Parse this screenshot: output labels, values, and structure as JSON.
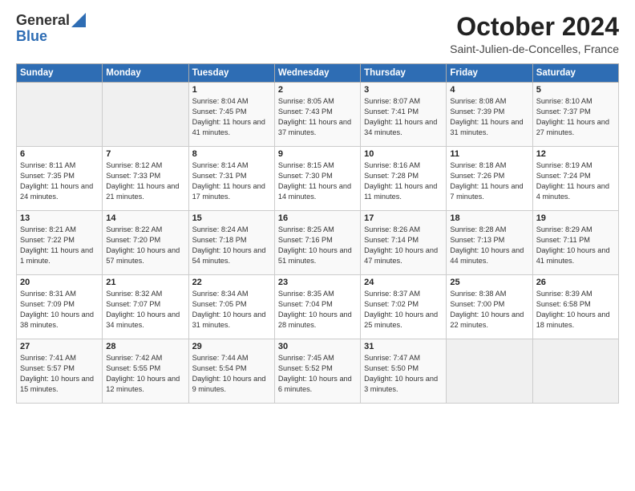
{
  "logo": {
    "general": "General",
    "blue": "Blue"
  },
  "title": "October 2024",
  "location": "Saint-Julien-de-Concelles, France",
  "headers": [
    "Sunday",
    "Monday",
    "Tuesday",
    "Wednesday",
    "Thursday",
    "Friday",
    "Saturday"
  ],
  "weeks": [
    [
      {
        "day": "",
        "info": ""
      },
      {
        "day": "",
        "info": ""
      },
      {
        "day": "1",
        "info": "Sunrise: 8:04 AM\nSunset: 7:45 PM\nDaylight: 11 hours and 41 minutes."
      },
      {
        "day": "2",
        "info": "Sunrise: 8:05 AM\nSunset: 7:43 PM\nDaylight: 11 hours and 37 minutes."
      },
      {
        "day": "3",
        "info": "Sunrise: 8:07 AM\nSunset: 7:41 PM\nDaylight: 11 hours and 34 minutes."
      },
      {
        "day": "4",
        "info": "Sunrise: 8:08 AM\nSunset: 7:39 PM\nDaylight: 11 hours and 31 minutes."
      },
      {
        "day": "5",
        "info": "Sunrise: 8:10 AM\nSunset: 7:37 PM\nDaylight: 11 hours and 27 minutes."
      }
    ],
    [
      {
        "day": "6",
        "info": "Sunrise: 8:11 AM\nSunset: 7:35 PM\nDaylight: 11 hours and 24 minutes."
      },
      {
        "day": "7",
        "info": "Sunrise: 8:12 AM\nSunset: 7:33 PM\nDaylight: 11 hours and 21 minutes."
      },
      {
        "day": "8",
        "info": "Sunrise: 8:14 AM\nSunset: 7:31 PM\nDaylight: 11 hours and 17 minutes."
      },
      {
        "day": "9",
        "info": "Sunrise: 8:15 AM\nSunset: 7:30 PM\nDaylight: 11 hours and 14 minutes."
      },
      {
        "day": "10",
        "info": "Sunrise: 8:16 AM\nSunset: 7:28 PM\nDaylight: 11 hours and 11 minutes."
      },
      {
        "day": "11",
        "info": "Sunrise: 8:18 AM\nSunset: 7:26 PM\nDaylight: 11 hours and 7 minutes."
      },
      {
        "day": "12",
        "info": "Sunrise: 8:19 AM\nSunset: 7:24 PM\nDaylight: 11 hours and 4 minutes."
      }
    ],
    [
      {
        "day": "13",
        "info": "Sunrise: 8:21 AM\nSunset: 7:22 PM\nDaylight: 11 hours and 1 minute."
      },
      {
        "day": "14",
        "info": "Sunrise: 8:22 AM\nSunset: 7:20 PM\nDaylight: 10 hours and 57 minutes."
      },
      {
        "day": "15",
        "info": "Sunrise: 8:24 AM\nSunset: 7:18 PM\nDaylight: 10 hours and 54 minutes."
      },
      {
        "day": "16",
        "info": "Sunrise: 8:25 AM\nSunset: 7:16 PM\nDaylight: 10 hours and 51 minutes."
      },
      {
        "day": "17",
        "info": "Sunrise: 8:26 AM\nSunset: 7:14 PM\nDaylight: 10 hours and 47 minutes."
      },
      {
        "day": "18",
        "info": "Sunrise: 8:28 AM\nSunset: 7:13 PM\nDaylight: 10 hours and 44 minutes."
      },
      {
        "day": "19",
        "info": "Sunrise: 8:29 AM\nSunset: 7:11 PM\nDaylight: 10 hours and 41 minutes."
      }
    ],
    [
      {
        "day": "20",
        "info": "Sunrise: 8:31 AM\nSunset: 7:09 PM\nDaylight: 10 hours and 38 minutes."
      },
      {
        "day": "21",
        "info": "Sunrise: 8:32 AM\nSunset: 7:07 PM\nDaylight: 10 hours and 34 minutes."
      },
      {
        "day": "22",
        "info": "Sunrise: 8:34 AM\nSunset: 7:05 PM\nDaylight: 10 hours and 31 minutes."
      },
      {
        "day": "23",
        "info": "Sunrise: 8:35 AM\nSunset: 7:04 PM\nDaylight: 10 hours and 28 minutes."
      },
      {
        "day": "24",
        "info": "Sunrise: 8:37 AM\nSunset: 7:02 PM\nDaylight: 10 hours and 25 minutes."
      },
      {
        "day": "25",
        "info": "Sunrise: 8:38 AM\nSunset: 7:00 PM\nDaylight: 10 hours and 22 minutes."
      },
      {
        "day": "26",
        "info": "Sunrise: 8:39 AM\nSunset: 6:58 PM\nDaylight: 10 hours and 18 minutes."
      }
    ],
    [
      {
        "day": "27",
        "info": "Sunrise: 7:41 AM\nSunset: 5:57 PM\nDaylight: 10 hours and 15 minutes."
      },
      {
        "day": "28",
        "info": "Sunrise: 7:42 AM\nSunset: 5:55 PM\nDaylight: 10 hours and 12 minutes."
      },
      {
        "day": "29",
        "info": "Sunrise: 7:44 AM\nSunset: 5:54 PM\nDaylight: 10 hours and 9 minutes."
      },
      {
        "day": "30",
        "info": "Sunrise: 7:45 AM\nSunset: 5:52 PM\nDaylight: 10 hours and 6 minutes."
      },
      {
        "day": "31",
        "info": "Sunrise: 7:47 AM\nSunset: 5:50 PM\nDaylight: 10 hours and 3 minutes."
      },
      {
        "day": "",
        "info": ""
      },
      {
        "day": "",
        "info": ""
      }
    ]
  ]
}
